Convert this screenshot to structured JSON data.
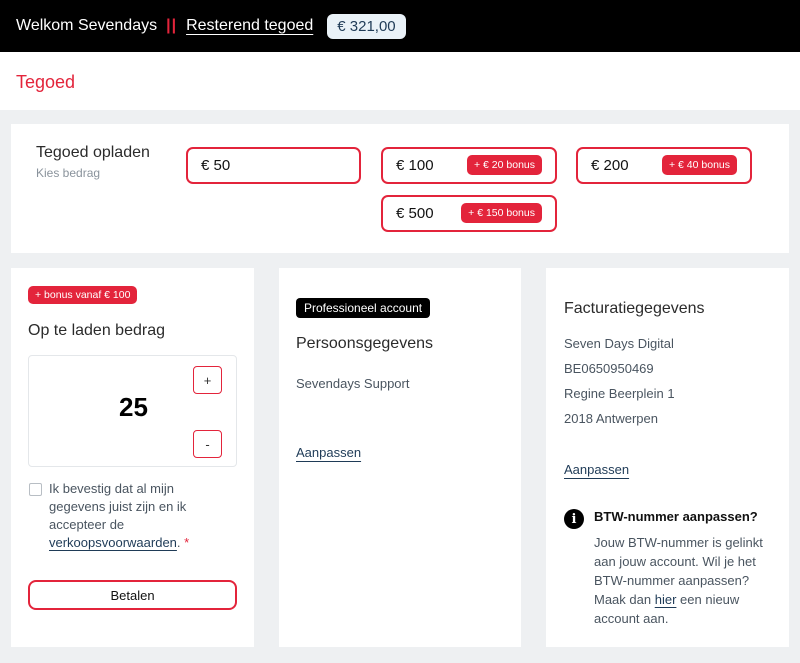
{
  "header": {
    "welcome": "Welkom Sevendays",
    "separator": "||",
    "balance_label": "Resterend tegoed",
    "balance_value": "€ 321,00"
  },
  "page": {
    "title": "Tegoed"
  },
  "topup": {
    "title": "Tegoed opladen",
    "subtitle": "Kies bedrag",
    "options": [
      {
        "amount": "€ 50",
        "bonus": ""
      },
      {
        "amount": "€ 100",
        "bonus": "+ € 20 bonus"
      },
      {
        "amount": "€ 200",
        "bonus": "+ € 40 bonus"
      },
      {
        "amount": "€ 500",
        "bonus": "+ € 150 bonus"
      }
    ]
  },
  "custom_amount": {
    "bonus_badge": "+ bonus vanaf € 100",
    "title": "Op te laden bedrag",
    "value": "25",
    "increment": "+",
    "decrement": "-",
    "consent_text": "Ik bevestig dat al mijn gegevens juist zijn en ik accepteer de",
    "consent_link": "verkoopsvoorwaarden",
    "consent_suffix": ".",
    "required_mark": "*",
    "pay_label": "Betalen"
  },
  "personal": {
    "badge": "Professioneel account",
    "title": "Persoonsgegevens",
    "name": "Sevendays Support",
    "edit_label": "Aanpassen"
  },
  "billing": {
    "title": "Facturatiegegevens",
    "company": "Seven Days Digital",
    "vat": "BE0650950469",
    "street": "Regine Beerplein 1",
    "city": "2018 Antwerpen",
    "edit_label": "Aanpassen",
    "info_icon": "i",
    "info_title": "BTW-nummer aanpassen?",
    "info_text_before": "Jouw BTW-nummer is gelinkt aan jouw account. Wil je het BTW-nummer aanpassen? Maak dan",
    "info_link": "hier",
    "info_text_after": "een nieuw account aan."
  }
}
